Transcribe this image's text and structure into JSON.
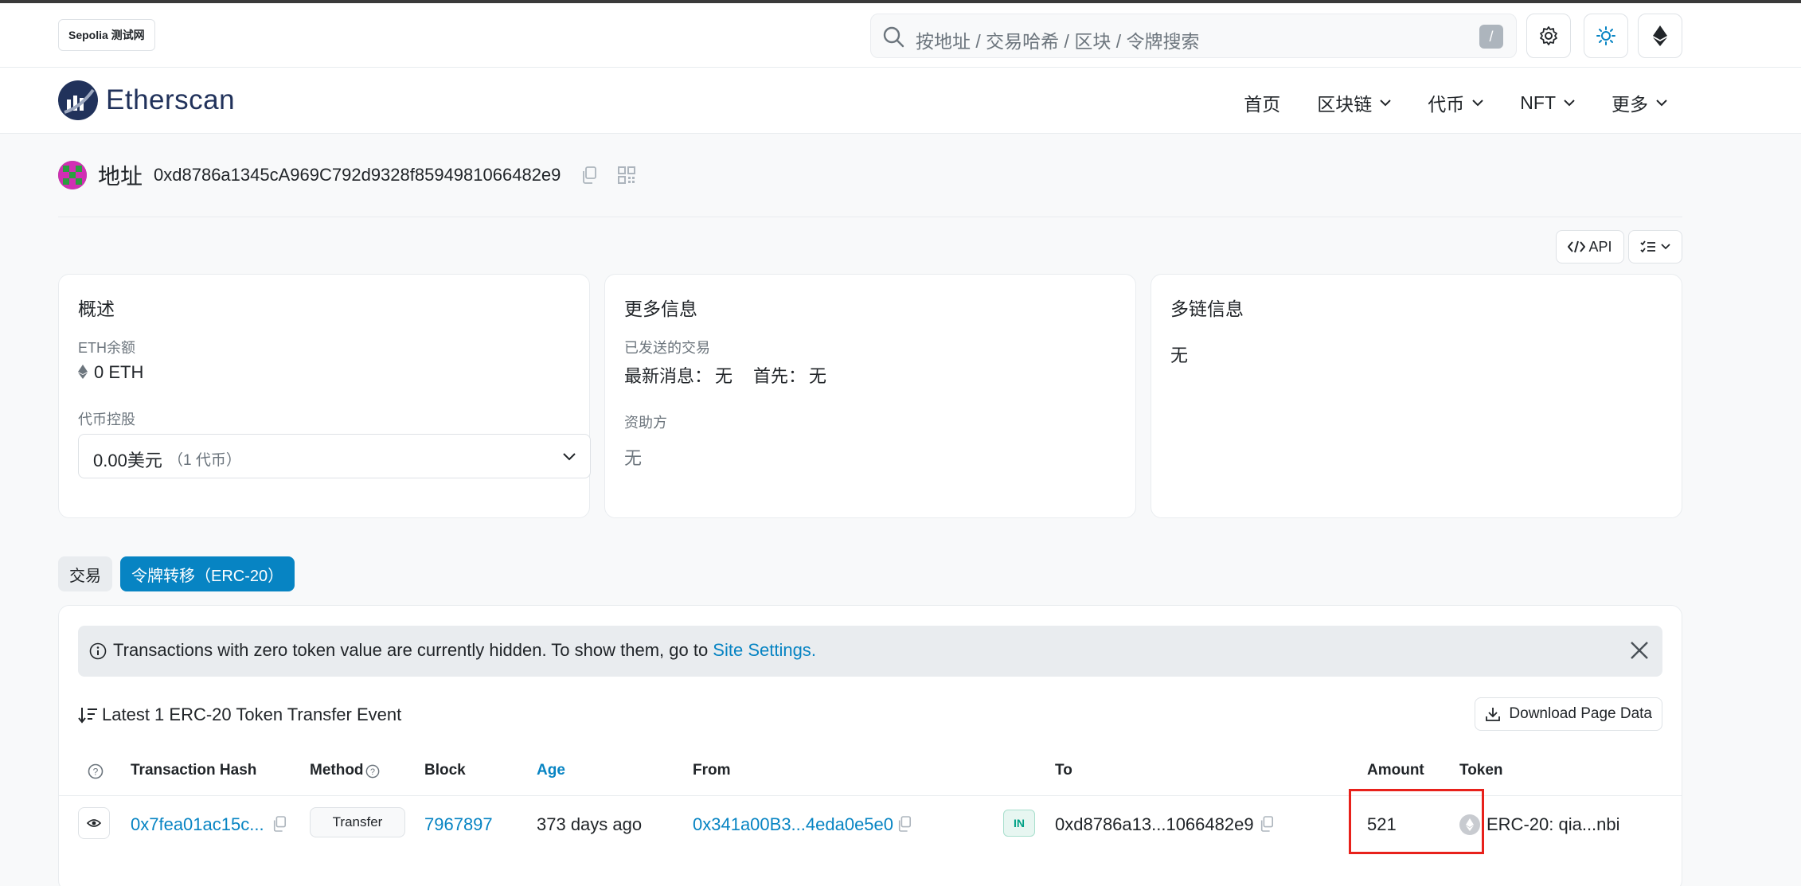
{
  "network_badge": "Sepolia 测试网",
  "search": {
    "placeholder": "按地址 / 交易哈希 / 区块 / 令牌搜索",
    "shortcut": "/"
  },
  "brand": {
    "name": "Etherscan"
  },
  "nav": [
    {
      "label": "首页"
    },
    {
      "label": "区块链"
    },
    {
      "label": "代币"
    },
    {
      "label": "NFT"
    },
    {
      "label": "更多"
    }
  ],
  "address": {
    "label": "地址",
    "value": "0xd8786a1345cA969C792d9328f8594981066482e9"
  },
  "toolbar": {
    "api_label": "API"
  },
  "overview": {
    "title": "概述",
    "eth_balance_label": "ETH余额",
    "eth_balance_value": "0 ETH",
    "holdings_label": "代币控股",
    "holdings_value": "0.00美元",
    "holdings_count": "（1 代币）"
  },
  "more_info": {
    "title": "更多信息",
    "sent_tx_label": "已发送的交易",
    "latest_label": "最新消息：",
    "latest_value": "无",
    "first_label": "首先：",
    "first_value": "无",
    "funded_by_label": "资助方",
    "funded_by_value": "无"
  },
  "multichain": {
    "title": "多链信息",
    "value": "无"
  },
  "tabs": [
    {
      "label": "交易",
      "active": false
    },
    {
      "label": "令牌转移（ERC-20）",
      "active": true
    }
  ],
  "notice": {
    "text": "Transactions with zero token value are currently hidden. To show them, go to ",
    "link": "Site Settings",
    "suffix": "."
  },
  "summary": "Latest 1 ERC-20 Token Transfer Event",
  "download_label": "Download Page Data",
  "table": {
    "headers": {
      "hash": "Transaction Hash",
      "method": "Method",
      "block": "Block",
      "age": "Age",
      "from": "From",
      "to": "To",
      "amount": "Amount",
      "token": "Token"
    },
    "rows": [
      {
        "hash": "0x7fea01ac15c...",
        "method": "Transfer",
        "block": "7967897",
        "age": "373 days ago",
        "from": "0x341a00B3...4eda0e5e0",
        "direction": "IN",
        "to": "0xd8786a13...1066482e9",
        "amount": "521",
        "token": "ERC-20: qia...nbi"
      }
    ]
  },
  "colors": {
    "accent": "#0784c3",
    "brand": "#21325b",
    "highlight": "#e8211b",
    "in_badge": "#00a186"
  }
}
